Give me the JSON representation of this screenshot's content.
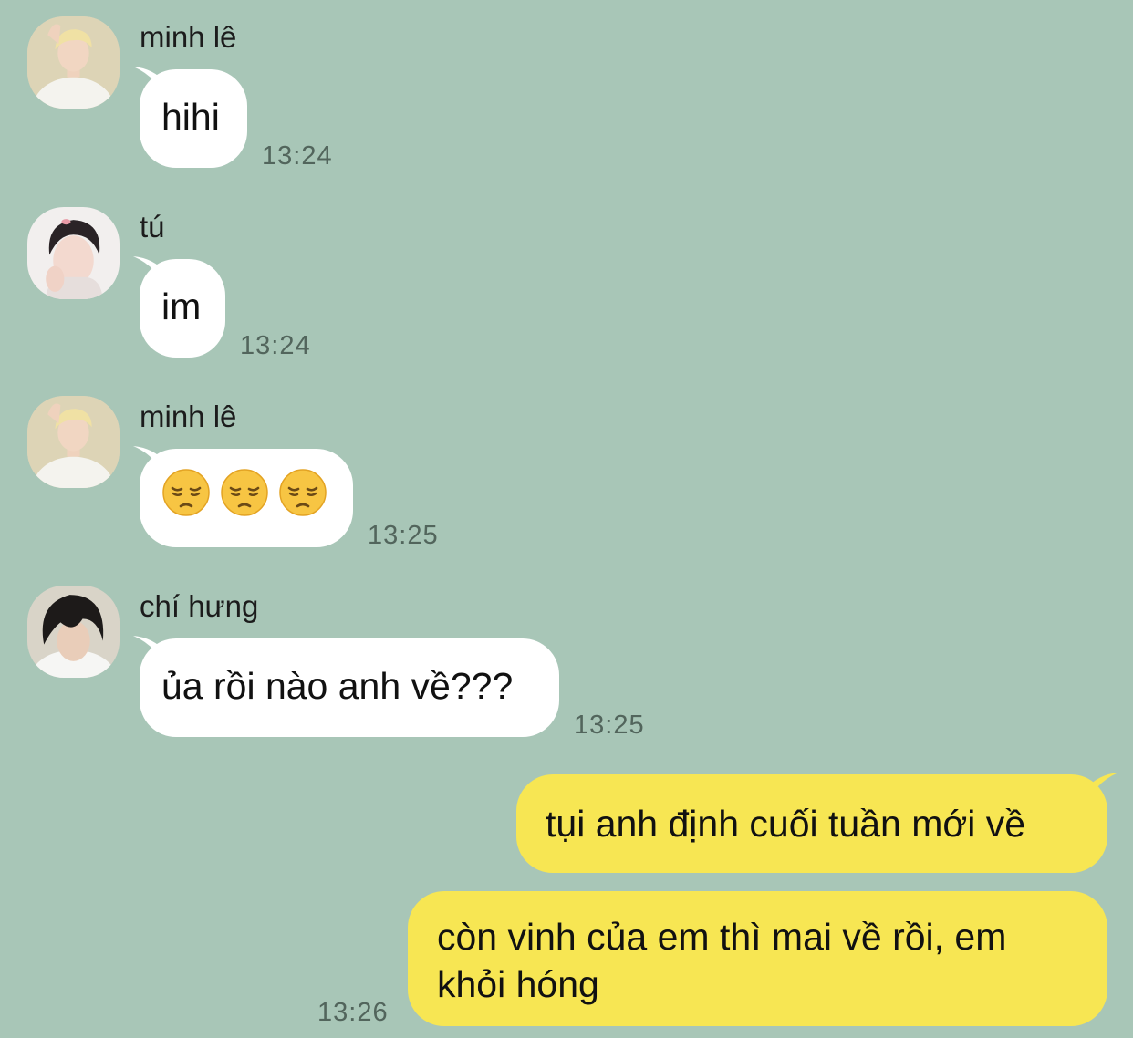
{
  "messages": [
    {
      "sender": "minh lê",
      "text": "hihi",
      "time": "13:24",
      "avatar": "avatar-blonde-hair-white-shirt"
    },
    {
      "sender": "tú",
      "text": "im",
      "time": "13:24",
      "avatar": "avatar-dark-hair-hand-on-face"
    },
    {
      "sender": "minh lê",
      "emojis": [
        "pensive-face-icon",
        "pensive-face-icon",
        "pensive-face-icon"
      ],
      "time": "13:25",
      "avatar": "avatar-blonde-hair-white-shirt"
    },
    {
      "sender": "chí hưng",
      "text": "ủa rồi nào anh về???",
      "time": "13:25",
      "avatar": "avatar-black-fluffy-hair"
    }
  ],
  "outgoing": [
    {
      "text": "tụi anh định cuối tuần mới về"
    },
    {
      "line1": "còn vinh của em thì mai về rồi, em",
      "line2": "khỏi hóng",
      "time": "13:26"
    }
  ],
  "colors": {
    "background": "#a8c6b7",
    "incoming_bubble": "#ffffff",
    "outgoing_bubble": "#f7e653",
    "timestamp": "#52655c"
  }
}
